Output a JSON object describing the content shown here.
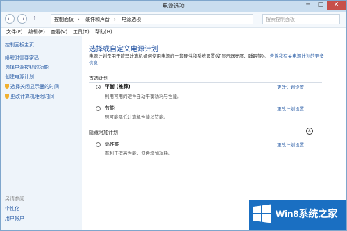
{
  "window": {
    "title": "电源选项",
    "minimize": "─",
    "maximize": "□",
    "close": "✕"
  },
  "address": {
    "path": [
      "控制面板",
      "硬件和声音",
      "电源选项"
    ],
    "separator": "›",
    "search_placeholder": "搜索控制面板"
  },
  "menu": [
    "文件(F)",
    "编辑(E)",
    "查看(V)",
    "工具(T)",
    "帮助(H)"
  ],
  "sidebar": {
    "home": "控制面板主页",
    "links": [
      "唤醒时需要密码",
      "选择电源按钮的功能",
      "创建电源计划",
      "选择关闭显示器的时间",
      "更改计算机睡眠时间"
    ],
    "see_also_title": "另请参阅",
    "see_also": [
      "个性化",
      "用户帐户"
    ]
  },
  "main": {
    "heading": "选择或自定义电源计划",
    "description": "电源计划是用于管理计算机如何使用电源的一套硬件和系统设置(如显示器亮度、睡眠等)。",
    "description_link": "告诉我有关电源计划的更多信息",
    "preferred_title": "首选计划",
    "hidden_title": "隐藏附加计划",
    "change_label": "更改计划设置",
    "plans": [
      {
        "name": "平衡 (推荐)",
        "desc": "利用可用的硬件自动平衡功耗与性能。",
        "selected": true
      },
      {
        "name": "节能",
        "desc": "尽可能降低计算机性能以节能。",
        "selected": false
      },
      {
        "name": "高性能",
        "desc": "有利于提高性能，但会增加功耗。",
        "selected": false
      }
    ]
  },
  "watermark": {
    "text": "Win8系统之家",
    "colors": {
      "bg": "#1a6fc2",
      "accent": "#ffffff"
    }
  }
}
